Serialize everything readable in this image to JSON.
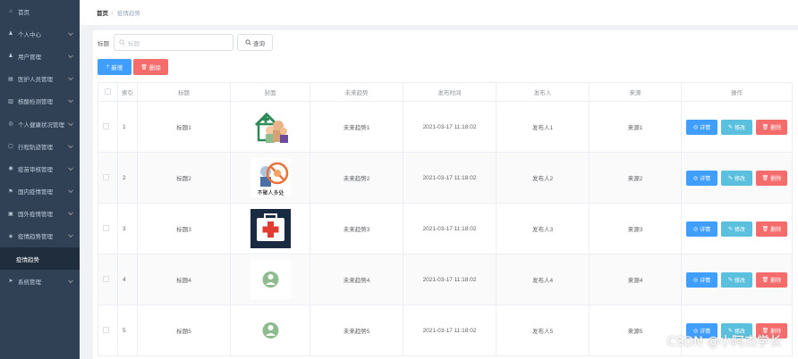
{
  "sidebar": {
    "items": [
      {
        "label": "首页",
        "icon": "home-icon"
      },
      {
        "label": "个人中心",
        "icon": "user-icon"
      },
      {
        "label": "用户管理",
        "icon": "user-icon"
      },
      {
        "label": "医护人员管理",
        "icon": "nurse-icon"
      },
      {
        "label": "核酸检测管理",
        "icon": "test-icon"
      },
      {
        "label": "个人健康状况管理",
        "icon": "health-icon"
      },
      {
        "label": "行程轨迹管理",
        "icon": "route-icon"
      },
      {
        "label": "疫苗审核管理",
        "icon": "audit-icon"
      },
      {
        "label": "国内疫情管理",
        "icon": "flag-icon"
      },
      {
        "label": "国外疫情管理",
        "icon": "globe-icon"
      },
      {
        "label": "疫情趋势管理",
        "icon": "trend-icon"
      }
    ],
    "sub_item": "疫情趋势",
    "last_item": {
      "label": "系统管理",
      "icon": "send-icon"
    }
  },
  "breadcrumb": {
    "home": "首页",
    "separator": "/",
    "current": "疫情趋势"
  },
  "search": {
    "label": "标题",
    "placeholder": "标题",
    "query_button": "查询"
  },
  "actions": {
    "add": "新增",
    "delete": "删除"
  },
  "table": {
    "headers": [
      "",
      "索引",
      "标题",
      "封面",
      "未来趋势",
      "发布时间",
      "发布人",
      "来源",
      "操作"
    ],
    "rows": [
      {
        "index": "1",
        "title": "标题1",
        "trend": "未来趋势1",
        "time": "2021-03-17 11:18:02",
        "publisher": "发布人1",
        "source": "来源1"
      },
      {
        "index": "2",
        "title": "标题2",
        "trend": "未来趋势2",
        "time": "2021-03-17 11:18:02",
        "publisher": "发布人2",
        "source": "来源2"
      },
      {
        "index": "3",
        "title": "标题3",
        "trend": "未来趋势3",
        "time": "2021-03-17 11:18:02",
        "publisher": "发布人3",
        "source": "来源3"
      },
      {
        "index": "4",
        "title": "标题4",
        "trend": "未来趋势4",
        "time": "2021-03-17 11:18:02",
        "publisher": "发布人4",
        "source": "来源4"
      },
      {
        "index": "5",
        "title": "标题5",
        "trend": "未来趋势5",
        "time": "2021-03-17 11:18:02",
        "publisher": "发布人5",
        "source": "来源5"
      }
    ],
    "op_labels": {
      "detail": "详情",
      "edit": "修改",
      "delete": "删除"
    },
    "cover2_caption": "不聚人多处"
  },
  "watermark": "CSDN @小阿杰学长",
  "colors": {
    "sidebar_bg": "#304156",
    "primary": "#409eff",
    "danger": "#f56c6c",
    "info": "#5bc0de"
  }
}
